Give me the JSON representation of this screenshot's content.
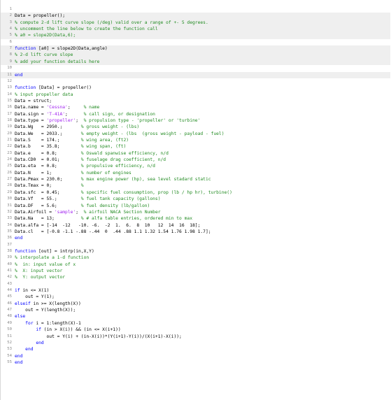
{
  "editor": {
    "lines": [
      {
        "n": "1",
        "shaded": false,
        "segs": []
      },
      {
        "n": "2",
        "shaded": true,
        "segs": [
          {
            "t": "Data = propeller();",
            "c": "tx"
          }
        ]
      },
      {
        "n": "3",
        "shaded": true,
        "segs": [
          {
            "t": "% compute 2-d lift curve slope (/deg) valid over a range of +- 5 degrees.",
            "c": "cm"
          }
        ]
      },
      {
        "n": "4",
        "shaded": true,
        "segs": [
          {
            "t": "% uncomment the line below to create the function call",
            "c": "cm"
          }
        ]
      },
      {
        "n": "5",
        "shaded": true,
        "segs": [
          {
            "t": "% a0 = slope2D(Data,6);",
            "c": "cm"
          }
        ]
      },
      {
        "n": "6",
        "shaded": false,
        "segs": []
      },
      {
        "n": "7",
        "shaded": true,
        "segs": [
          {
            "t": "function",
            "c": "kw"
          },
          {
            "t": " [a0] = slope2D(Data,angle)",
            "c": "tx"
          }
        ]
      },
      {
        "n": "8",
        "shaded": true,
        "segs": [
          {
            "t": "% 2-d lift curve slope",
            "c": "cm"
          }
        ]
      },
      {
        "n": "9",
        "shaded": true,
        "segs": [
          {
            "t": "% add your function details here",
            "c": "cm"
          }
        ]
      },
      {
        "n": "10",
        "shaded": false,
        "segs": []
      },
      {
        "n": "11",
        "shaded": true,
        "segs": [
          {
            "t": "end",
            "c": "kw"
          }
        ]
      },
      {
        "n": "12",
        "shaded": false,
        "segs": []
      },
      {
        "n": "13",
        "shaded": false,
        "segs": [
          {
            "t": "function",
            "c": "kw"
          },
          {
            "t": " [Data] = propeller()",
            "c": "tx"
          }
        ]
      },
      {
        "n": "14",
        "shaded": false,
        "segs": [
          {
            "t": "% input propeller data",
            "c": "cm"
          }
        ]
      },
      {
        "n": "15",
        "shaded": false,
        "segs": [
          {
            "t": "Data = struct;",
            "c": "tx"
          }
        ]
      },
      {
        "n": "16",
        "shaded": false,
        "segs": [
          {
            "t": "Data.name = ",
            "c": "tx"
          },
          {
            "t": "'Cessna'",
            "c": "str"
          },
          {
            "t": ";     ",
            "c": "tx"
          },
          {
            "t": "% name",
            "c": "cm"
          }
        ]
      },
      {
        "n": "17",
        "shaded": false,
        "segs": [
          {
            "t": "Data.sign = ",
            "c": "tx"
          },
          {
            "t": "'T-41A'",
            "c": "str"
          },
          {
            "t": ";      ",
            "c": "tx"
          },
          {
            "t": "% call sign, or designation",
            "c": "cm"
          }
        ]
      },
      {
        "n": "18",
        "shaded": false,
        "segs": [
          {
            "t": "Data.type = ",
            "c": "tx"
          },
          {
            "t": "'propeller'",
            "c": "str"
          },
          {
            "t": ";  ",
            "c": "tx"
          },
          {
            "t": "% propulsion type - 'propeller' or 'turbine'",
            "c": "cm"
          }
        ]
      },
      {
        "n": "19",
        "shaded": false,
        "segs": [
          {
            "t": "Data.Wg   = 2950.;       ",
            "c": "tx"
          },
          {
            "t": "% gross weight - (lbs)",
            "c": "cm"
          }
        ]
      },
      {
        "n": "20",
        "shaded": false,
        "segs": [
          {
            "t": "Data.We   = 2033.;       ",
            "c": "tx"
          },
          {
            "t": "% empty weight - (lbs  (gross weight - payload - fuel)",
            "c": "cm"
          }
        ]
      },
      {
        "n": "21",
        "shaded": false,
        "segs": [
          {
            "t": "Data.S    = 174.;        ",
            "c": "tx"
          },
          {
            "t": "% wing area, (ft2)",
            "c": "cm"
          }
        ]
      },
      {
        "n": "22",
        "shaded": false,
        "segs": [
          {
            "t": "Data.b    = 35.8;        ",
            "c": "tx"
          },
          {
            "t": "% wing span, (ft)",
            "c": "cm"
          }
        ]
      },
      {
        "n": "23",
        "shaded": false,
        "segs": [
          {
            "t": "Data.e    = 0.8;         ",
            "c": "tx"
          },
          {
            "t": "% Oswald spanwise efficiency, n/d",
            "c": "cm"
          }
        ]
      },
      {
        "n": "24",
        "shaded": false,
        "segs": [
          {
            "t": "Data.CD0  = 0.01;        ",
            "c": "tx"
          },
          {
            "t": "% fuselage drag coefficient, n/d",
            "c": "cm"
          }
        ]
      },
      {
        "n": "25",
        "shaded": false,
        "segs": [
          {
            "t": "Data.eta  = 0.8;         ",
            "c": "tx"
          },
          {
            "t": "% propulsive efficiency, n/d",
            "c": "cm"
          }
        ]
      },
      {
        "n": "26",
        "shaded": false,
        "segs": [
          {
            "t": "Data.N    = 1;           ",
            "c": "tx"
          },
          {
            "t": "% number of engines",
            "c": "cm"
          }
        ]
      },
      {
        "n": "27",
        "shaded": false,
        "segs": [
          {
            "t": "Data.Pmax = 230.0;       ",
            "c": "tx"
          },
          {
            "t": "% max engine power (hp), sea level stadard static",
            "c": "cm"
          }
        ]
      },
      {
        "n": "28",
        "shaded": false,
        "segs": [
          {
            "t": "Data.Tmax = 0;           ",
            "c": "tx"
          },
          {
            "t": "%",
            "c": "cm"
          }
        ]
      },
      {
        "n": "29",
        "shaded": false,
        "segs": [
          {
            "t": "Data.sfc  = 0.45;        ",
            "c": "tx"
          },
          {
            "t": "% specific fuel consumption, prop (lb / hp hr), turbine()",
            "c": "cm"
          }
        ]
      },
      {
        "n": "30",
        "shaded": false,
        "segs": [
          {
            "t": "Data.Vf   = 55.;         ",
            "c": "tx"
          },
          {
            "t": "% fuel tank capacity (gallons)",
            "c": "cm"
          }
        ]
      },
      {
        "n": "31",
        "shaded": false,
        "segs": [
          {
            "t": "Data.DF   = 5.6;         ",
            "c": "tx"
          },
          {
            "t": "% fuel density (lb/gallon)",
            "c": "cm"
          }
        ]
      },
      {
        "n": "32",
        "shaded": false,
        "segs": [
          {
            "t": "Data.Airfoil = ",
            "c": "tx"
          },
          {
            "t": "'sample'",
            "c": "str"
          },
          {
            "t": ";  ",
            "c": "tx"
          },
          {
            "t": "% airfoil NACA Section Number",
            "c": "cm"
          }
        ]
      },
      {
        "n": "33",
        "shaded": false,
        "segs": [
          {
            "t": "Data.Na   = 13;          ",
            "c": "tx"
          },
          {
            "t": "% # alfa table entries, ordered min to max",
            "c": "cm"
          }
        ]
      },
      {
        "n": "34",
        "shaded": false,
        "segs": [
          {
            "t": "Data.alfa = [-14  -12   -10. -6.  -2  1.  6.  8  10   12  14  16  18];",
            "c": "tx"
          }
        ]
      },
      {
        "n": "35",
        "shaded": false,
        "segs": [
          {
            "t": "Data.cl   = [-0.8 -1.1 -.88 -.44  0  .44 .88 1.1 1.32 1.54 1.76 1.98 1.7];",
            "c": "tx"
          }
        ]
      },
      {
        "n": "36",
        "shaded": false,
        "segs": [
          {
            "t": "end",
            "c": "kw"
          }
        ]
      },
      {
        "n": "37",
        "shaded": false,
        "segs": []
      },
      {
        "n": "38",
        "shaded": false,
        "segs": [
          {
            "t": "function",
            "c": "kw"
          },
          {
            "t": " [out] = intrp(in,X,Y)",
            "c": "tx"
          }
        ]
      },
      {
        "n": "39",
        "shaded": false,
        "segs": [
          {
            "t": "% interpolate a 1-d function",
            "c": "cm"
          }
        ]
      },
      {
        "n": "40",
        "shaded": false,
        "segs": [
          {
            "t": "%  in: input value of x",
            "c": "cm"
          }
        ]
      },
      {
        "n": "41",
        "shaded": false,
        "segs": [
          {
            "t": "%  X: input vector",
            "c": "cm"
          }
        ]
      },
      {
        "n": "42",
        "shaded": false,
        "segs": [
          {
            "t": "%  Y: output vector",
            "c": "cm"
          }
        ]
      },
      {
        "n": "43",
        "shaded": false,
        "segs": []
      },
      {
        "n": "44",
        "shaded": false,
        "segs": [
          {
            "t": "if",
            "c": "kw"
          },
          {
            "t": " in <= X(1)",
            "c": "tx"
          }
        ]
      },
      {
        "n": "45",
        "shaded": false,
        "segs": [
          {
            "t": "    out = Y(1);",
            "c": "tx"
          }
        ]
      },
      {
        "n": "46",
        "shaded": false,
        "segs": [
          {
            "t": "elseif",
            "c": "kw"
          },
          {
            "t": " in >= X(length(X))",
            "c": "tx"
          }
        ]
      },
      {
        "n": "47",
        "shaded": false,
        "segs": [
          {
            "t": "    out = Y(length(X));",
            "c": "tx"
          }
        ]
      },
      {
        "n": "48",
        "shaded": false,
        "segs": [
          {
            "t": "else",
            "c": "kw"
          }
        ]
      },
      {
        "n": "49",
        "shaded": false,
        "segs": [
          {
            "t": "    ",
            "c": "tx"
          },
          {
            "t": "for",
            "c": "kw"
          },
          {
            "t": " i = 1:length(X)-1",
            "c": "tx"
          }
        ]
      },
      {
        "n": "50",
        "shaded": false,
        "segs": [
          {
            "t": "        ",
            "c": "tx"
          },
          {
            "t": "if",
            "c": "kw"
          },
          {
            "t": " (in > X(i)) && (in <= X(i+1))",
            "c": "tx"
          }
        ]
      },
      {
        "n": "51",
        "shaded": false,
        "segs": [
          {
            "t": "            out = Y(i) + (in-X(i))*(Y(i+1)-Y(i))/(X(i+1)-X(i));",
            "c": "tx"
          }
        ]
      },
      {
        "n": "52",
        "shaded": false,
        "segs": [
          {
            "t": "        ",
            "c": "tx"
          },
          {
            "t": "end",
            "c": "kw"
          }
        ]
      },
      {
        "n": "53",
        "shaded": false,
        "segs": [
          {
            "t": "    ",
            "c": "tx"
          },
          {
            "t": "end",
            "c": "kw"
          }
        ]
      },
      {
        "n": "54",
        "shaded": false,
        "segs": [
          {
            "t": "end",
            "c": "kw"
          }
        ]
      },
      {
        "n": "55",
        "shaded": false,
        "segs": [
          {
            "t": "end",
            "c": "kw"
          }
        ]
      }
    ]
  }
}
